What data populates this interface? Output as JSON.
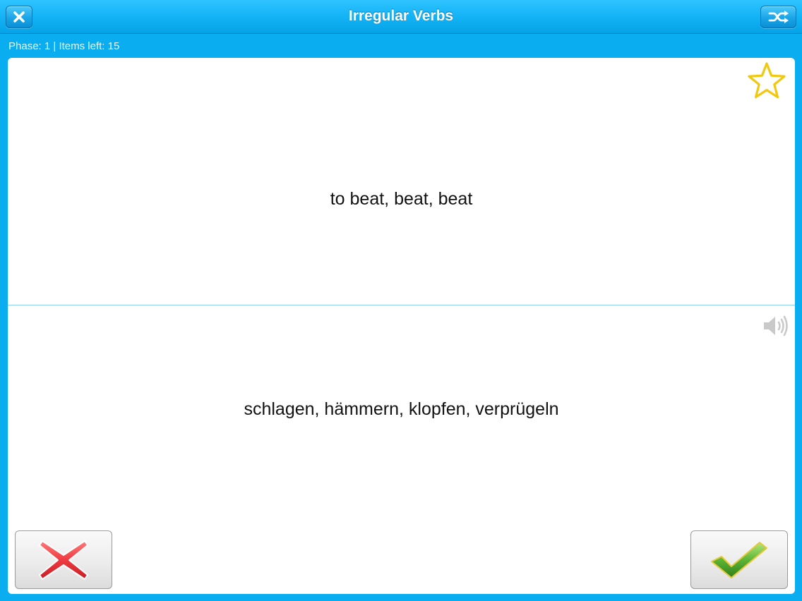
{
  "header": {
    "title": "Irregular Verbs",
    "close_icon": "close-icon",
    "shuffle_icon": "shuffle-icon"
  },
  "status": {
    "text": "Phase: 1 | Items left: 15"
  },
  "card": {
    "front": "to beat, beat, beat",
    "back": "schlagen, hämmern, klopfen, verprügeln",
    "favorite_icon": "star-outline-icon",
    "audio_icon": "speaker-icon"
  },
  "actions": {
    "wrong_icon": "red-x-icon",
    "right_icon": "green-check-icon"
  },
  "colors": {
    "background": "#0aaef0",
    "star": "#f2c80f",
    "wrong": "#e8343a",
    "right": "#4aa82c"
  }
}
